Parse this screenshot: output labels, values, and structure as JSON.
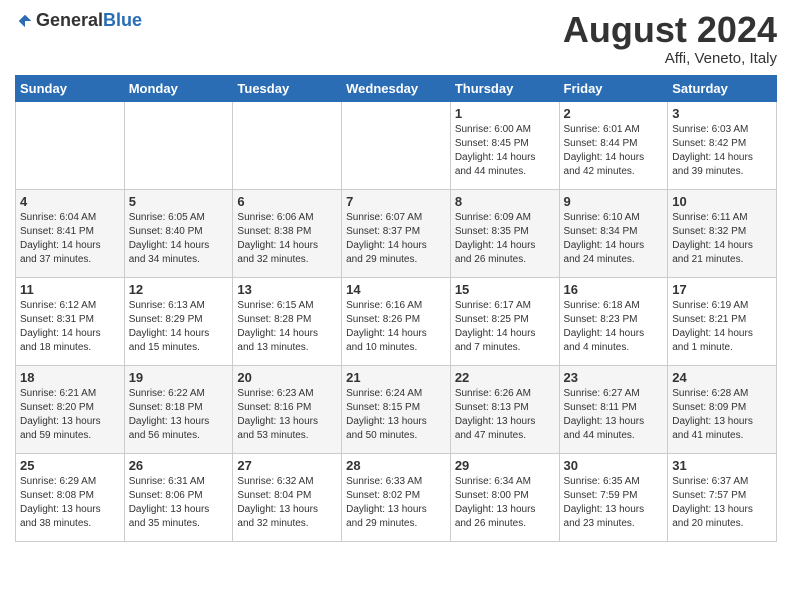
{
  "logo": {
    "general": "General",
    "blue": "Blue"
  },
  "header": {
    "month": "August 2024",
    "location": "Affi, Veneto, Italy"
  },
  "weekdays": [
    "Sunday",
    "Monday",
    "Tuesday",
    "Wednesday",
    "Thursday",
    "Friday",
    "Saturday"
  ],
  "weeks": [
    [
      {
        "day": "",
        "info": ""
      },
      {
        "day": "",
        "info": ""
      },
      {
        "day": "",
        "info": ""
      },
      {
        "day": "",
        "info": ""
      },
      {
        "day": "1",
        "info": "Sunrise: 6:00 AM\nSunset: 8:45 PM\nDaylight: 14 hours\nand 44 minutes."
      },
      {
        "day": "2",
        "info": "Sunrise: 6:01 AM\nSunset: 8:44 PM\nDaylight: 14 hours\nand 42 minutes."
      },
      {
        "day": "3",
        "info": "Sunrise: 6:03 AM\nSunset: 8:42 PM\nDaylight: 14 hours\nand 39 minutes."
      }
    ],
    [
      {
        "day": "4",
        "info": "Sunrise: 6:04 AM\nSunset: 8:41 PM\nDaylight: 14 hours\nand 37 minutes."
      },
      {
        "day": "5",
        "info": "Sunrise: 6:05 AM\nSunset: 8:40 PM\nDaylight: 14 hours\nand 34 minutes."
      },
      {
        "day": "6",
        "info": "Sunrise: 6:06 AM\nSunset: 8:38 PM\nDaylight: 14 hours\nand 32 minutes."
      },
      {
        "day": "7",
        "info": "Sunrise: 6:07 AM\nSunset: 8:37 PM\nDaylight: 14 hours\nand 29 minutes."
      },
      {
        "day": "8",
        "info": "Sunrise: 6:09 AM\nSunset: 8:35 PM\nDaylight: 14 hours\nand 26 minutes."
      },
      {
        "day": "9",
        "info": "Sunrise: 6:10 AM\nSunset: 8:34 PM\nDaylight: 14 hours\nand 24 minutes."
      },
      {
        "day": "10",
        "info": "Sunrise: 6:11 AM\nSunset: 8:32 PM\nDaylight: 14 hours\nand 21 minutes."
      }
    ],
    [
      {
        "day": "11",
        "info": "Sunrise: 6:12 AM\nSunset: 8:31 PM\nDaylight: 14 hours\nand 18 minutes."
      },
      {
        "day": "12",
        "info": "Sunrise: 6:13 AM\nSunset: 8:29 PM\nDaylight: 14 hours\nand 15 minutes."
      },
      {
        "day": "13",
        "info": "Sunrise: 6:15 AM\nSunset: 8:28 PM\nDaylight: 14 hours\nand 13 minutes."
      },
      {
        "day": "14",
        "info": "Sunrise: 6:16 AM\nSunset: 8:26 PM\nDaylight: 14 hours\nand 10 minutes."
      },
      {
        "day": "15",
        "info": "Sunrise: 6:17 AM\nSunset: 8:25 PM\nDaylight: 14 hours\nand 7 minutes."
      },
      {
        "day": "16",
        "info": "Sunrise: 6:18 AM\nSunset: 8:23 PM\nDaylight: 14 hours\nand 4 minutes."
      },
      {
        "day": "17",
        "info": "Sunrise: 6:19 AM\nSunset: 8:21 PM\nDaylight: 14 hours\nand 1 minute."
      }
    ],
    [
      {
        "day": "18",
        "info": "Sunrise: 6:21 AM\nSunset: 8:20 PM\nDaylight: 13 hours\nand 59 minutes."
      },
      {
        "day": "19",
        "info": "Sunrise: 6:22 AM\nSunset: 8:18 PM\nDaylight: 13 hours\nand 56 minutes."
      },
      {
        "day": "20",
        "info": "Sunrise: 6:23 AM\nSunset: 8:16 PM\nDaylight: 13 hours\nand 53 minutes."
      },
      {
        "day": "21",
        "info": "Sunrise: 6:24 AM\nSunset: 8:15 PM\nDaylight: 13 hours\nand 50 minutes."
      },
      {
        "day": "22",
        "info": "Sunrise: 6:26 AM\nSunset: 8:13 PM\nDaylight: 13 hours\nand 47 minutes."
      },
      {
        "day": "23",
        "info": "Sunrise: 6:27 AM\nSunset: 8:11 PM\nDaylight: 13 hours\nand 44 minutes."
      },
      {
        "day": "24",
        "info": "Sunrise: 6:28 AM\nSunset: 8:09 PM\nDaylight: 13 hours\nand 41 minutes."
      }
    ],
    [
      {
        "day": "25",
        "info": "Sunrise: 6:29 AM\nSunset: 8:08 PM\nDaylight: 13 hours\nand 38 minutes."
      },
      {
        "day": "26",
        "info": "Sunrise: 6:31 AM\nSunset: 8:06 PM\nDaylight: 13 hours\nand 35 minutes."
      },
      {
        "day": "27",
        "info": "Sunrise: 6:32 AM\nSunset: 8:04 PM\nDaylight: 13 hours\nand 32 minutes."
      },
      {
        "day": "28",
        "info": "Sunrise: 6:33 AM\nSunset: 8:02 PM\nDaylight: 13 hours\nand 29 minutes."
      },
      {
        "day": "29",
        "info": "Sunrise: 6:34 AM\nSunset: 8:00 PM\nDaylight: 13 hours\nand 26 minutes."
      },
      {
        "day": "30",
        "info": "Sunrise: 6:35 AM\nSunset: 7:59 PM\nDaylight: 13 hours\nand 23 minutes."
      },
      {
        "day": "31",
        "info": "Sunrise: 6:37 AM\nSunset: 7:57 PM\nDaylight: 13 hours\nand 20 minutes."
      }
    ]
  ]
}
